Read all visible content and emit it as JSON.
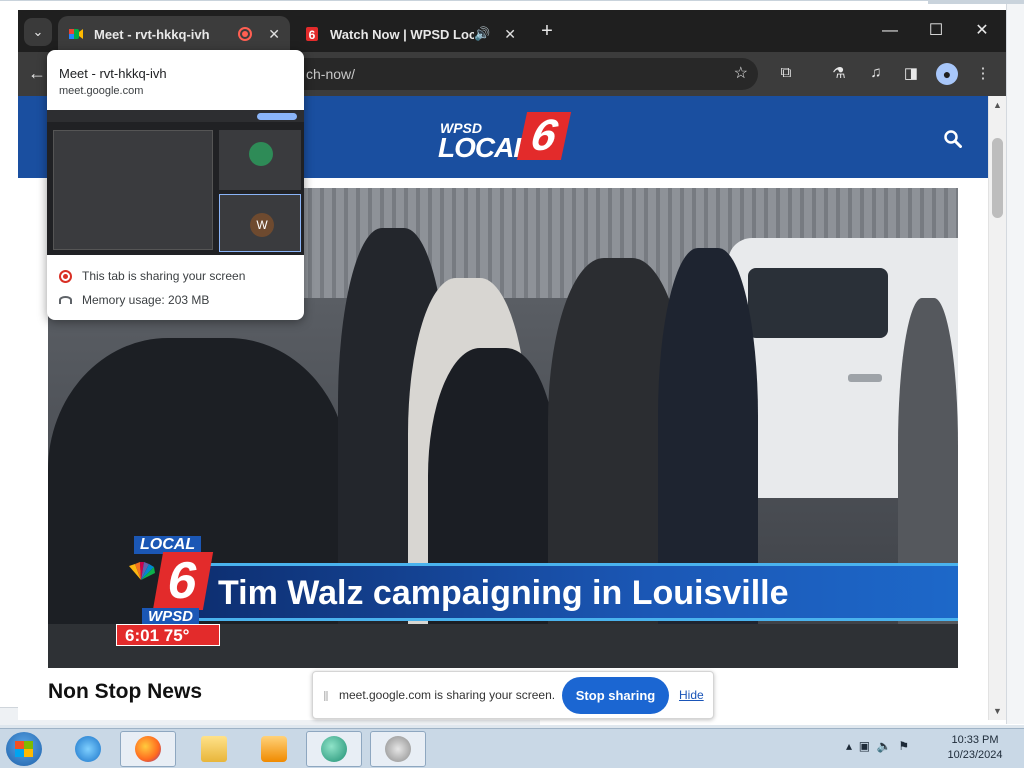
{
  "browser": {
    "tabs": [
      {
        "title": "Meet - rvt-hkkq-ivh",
        "active": true,
        "recording": true
      },
      {
        "title": "Watch Now | WPSD Local 6",
        "active": false,
        "audio": true
      }
    ],
    "omnibox_text": "ch-now/",
    "window_controls": {
      "minimize": "—",
      "maximize": "☐",
      "close": "✕"
    }
  },
  "hovercard": {
    "title": "Meet - rvt-hkkq-ivh",
    "url": "meet.google.com",
    "sharing_text": "This tab is sharing your screen",
    "memory_text": "Memory usage: 203 MB",
    "thumb_avatar": "W"
  },
  "site": {
    "logo_top": "WPSD",
    "logo_main": "LOCAL",
    "logo_num": "6"
  },
  "video": {
    "headline": "Tim Walz campaigning in Louisville",
    "bug_local": "LOCAL",
    "bug_num": "6",
    "bug_call": "WPSD",
    "time_temp": "6:01 75°"
  },
  "section": {
    "heading": "Non Stop News"
  },
  "share_bar": {
    "message": "meet.google.com is sharing your screen.",
    "stop_label": "Stop sharing",
    "hide_label": "Hide"
  },
  "taskbar": {
    "time": "10:33 PM",
    "date": "10/23/2024"
  },
  "icons": {
    "tab_search": "chevron-down-icon",
    "back": "back-arrow-icon",
    "star": "bookmark-star-icon",
    "extensions": "puzzle-icon",
    "labs": "flask-icon",
    "media": "media-queue-icon",
    "sidepanel": "side-panel-icon",
    "profile": "profile-icon",
    "menu": "kebab-menu-icon",
    "site_search": "search-icon"
  }
}
